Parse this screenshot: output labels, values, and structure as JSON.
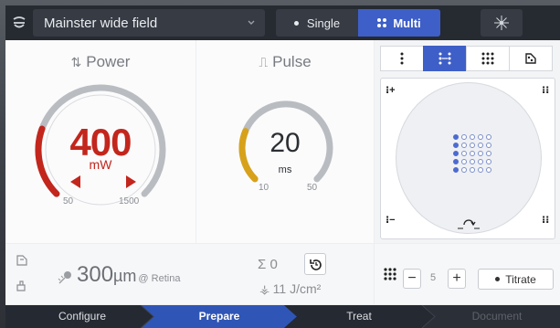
{
  "topbar": {
    "lens_label": "Mainster wide field",
    "mode_single": "Single",
    "mode_multi": "Multi",
    "active_mode": "Multi",
    "icons": [
      "lens-icon",
      "chevron-down-icon",
      "aiming-beam-icon"
    ]
  },
  "power": {
    "title": "Power",
    "value": "400",
    "unit": "mW",
    "min": "50",
    "max": "1500",
    "level": 0.24,
    "color": "#c3261c"
  },
  "pulse": {
    "title": "Pulse",
    "value": "20",
    "unit": "ms",
    "min": "10",
    "max": "50",
    "level": 0.25,
    "color": "#d7a21a"
  },
  "pattern": {
    "tabs": [
      "single-column-icon",
      "line-pattern-icon",
      "grid-pattern-icon",
      "custom-pattern-icon"
    ],
    "active_tab": 1,
    "grid_rows": 5,
    "grid_cols": 5,
    "selected_column": 0
  },
  "bottom": {
    "spot_size_value": "300",
    "spot_size_unit": "µm",
    "spot_size_suffix": "@ Retina",
    "count_label": "Σ 0",
    "fluence_value": "11 J/cm²",
    "step_value": "5",
    "minus": "−",
    "plus": "+",
    "titrate_label": "Titrate"
  },
  "workflow": {
    "steps": [
      "Configure",
      "Prepare",
      "Treat",
      "Document"
    ],
    "active": "Prepare"
  }
}
